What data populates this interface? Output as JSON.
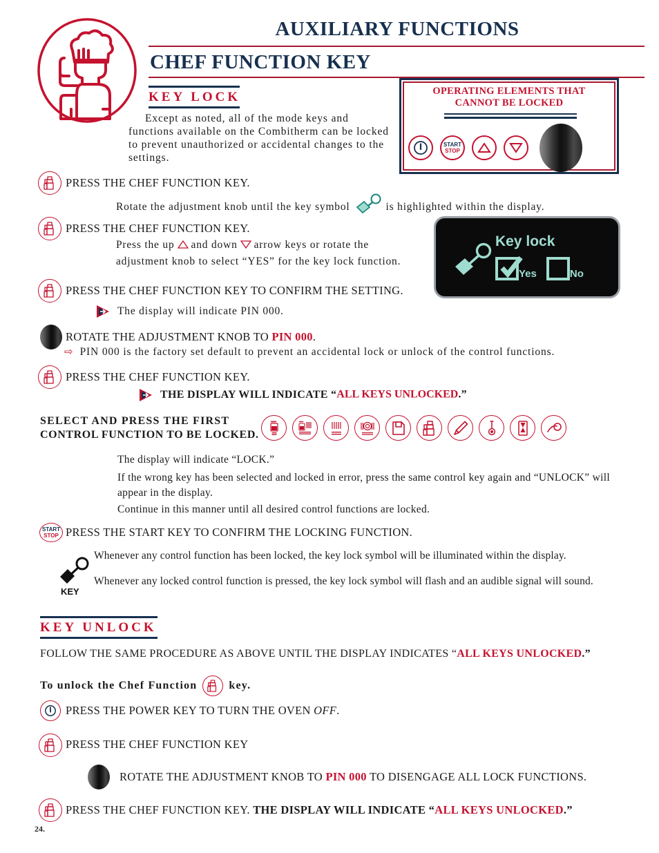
{
  "header": {
    "section_title": "AUXILIARY FUNCTIONS",
    "page_title": "CHEF FUNCTION KEY",
    "subsection_title": "KEY LOCK",
    "intro_paragraph": "Except as noted, all of the mode keys and functions available on the Combitherm can be locked to prevent unauthorized or accidental changes to the settings."
  },
  "operating_elements_box": {
    "title_line1": "OPERATING ELEMENTS THAT",
    "title_line2": "CANNOT BE LOCKED",
    "keys": [
      {
        "name": "power-key",
        "label": ""
      },
      {
        "name": "start-stop-key",
        "label_top": "START",
        "label_bottom": "STOP"
      },
      {
        "name": "up-arrow-key",
        "label": ""
      },
      {
        "name": "down-arrow-key",
        "label": ""
      },
      {
        "name": "adjustment-knob",
        "label": ""
      }
    ]
  },
  "steps": {
    "s1_main": "PRESS THE CHEF FUNCTION KEY.",
    "s1_sub_a": "Rotate the adjustment knob until the key symbol",
    "s1_sub_b": "is highlighted within the display.",
    "s2_main": "PRESS THE CHEF FUNCTION KEY.",
    "s2_sub_a": "Press the up",
    "s2_sub_b": "and down",
    "s2_sub_c": "arrow keys or rotate the",
    "s2_sub_d": "adjustment knob to select “YES” for the key lock function.",
    "s3_main": "PRESS THE CHEF FUNCTION KEY TO CONFIRM THE SETTING.",
    "s3_sub": "The display will indicate PIN 000.",
    "s4_main_a": "ROTATE THE ADJUSTMENT KNOB TO ",
    "s4_main_pin": "PIN 000",
    "s4_main_b": ".",
    "s4_note": "PIN 000 is the factory set default to prevent an accidental lock or unlock of the control functions.",
    "s5_main": "PRESS THE CHEF FUNCTION KEY.",
    "s5_sub_a": "THE DISPLAY WILL INDICATE “",
    "s5_sub_red": "ALL KEYS UNLOCKED",
    "s5_sub_b": ".”",
    "s6_main_line1": "SELECT AND PRESS THE FIRST",
    "s6_main_line2": "CONTROL FUNCTION TO BE LOCKED.",
    "s6_sub1": "The display will indicate “LOCK.”",
    "s6_sub2": "If the wrong key has been selected and locked in error, press the same control key again and “UNLOCK” will appear in the display.",
    "s6_sub3": "Continue in this manner until all desired control functions are locked.",
    "s7_main": "PRESS THE START KEY TO CONFIRM THE LOCKING FUNCTION.",
    "s7_sub1": "Whenever any control function has been locked, the key lock symbol will be illuminated within the display.",
    "s7_sub2": "Whenever any locked control function is pressed, the key lock symbol will flash and an audible signal will sound.",
    "key_symbol_label": "KEY"
  },
  "lcd_display": {
    "title": "Key lock",
    "option_yes": "Yes",
    "option_no": "No",
    "yes_checked": true,
    "no_checked": false,
    "screen_color": "#0b0b0b",
    "text_color": "#9fdcd0"
  },
  "control_function_icons": [
    "combi-steam-icon",
    "combi-convection-icon",
    "convection-icon",
    "retherm-icon",
    "memory-card-icon",
    "chef-function-icon",
    "pencil-edit-icon",
    "probe-thermometer-icon",
    "hourglass-timer-icon",
    "fan-speed-icon"
  ],
  "key_unlock": {
    "heading": "KEY UNLOCK",
    "line1_a": "FOLLOW THE SAME PROCEDURE AS ABOVE UNTIL THE DISPLAY INDICATES “",
    "line1_red": "ALL KEYS UNLOCKED",
    "line1_b": ".”",
    "line2_a": "To unlock the Chef Function",
    "line2_b": "key.",
    "u1_a": "PRESS THE POWER KEY TO TURN THE OVEN ",
    "u1_ital": "OFF",
    "u1_b": ".",
    "u2": "PRESS THE CHEF FUNCTION KEY",
    "u3_a": "ROTATE THE ADJUSTMENT KNOB TO ",
    "u3_pin": "PIN 000",
    "u3_b": " TO DISENGAGE ALL LOCK FUNCTIONS.",
    "u4_a": "PRESS THE CHEF FUNCTION KEY. ",
    "u4_bold": "THE DISPLAY WILL INDICATE “",
    "u4_red": "ALL KEYS UNLOCKED",
    "u4_b": ".”"
  },
  "footer": {
    "page_number": "24."
  },
  "colors": {
    "navy": "#17304f",
    "red": "#c4122f",
    "lcd_teal": "#9fdcd0",
    "black": "#0b0b0b"
  }
}
